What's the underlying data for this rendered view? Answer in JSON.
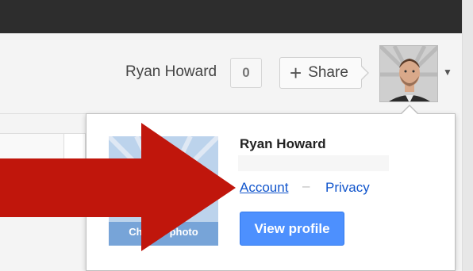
{
  "header": {
    "user_name": "Ryan Howard",
    "notification_count": "0",
    "share_label": "Share"
  },
  "popup": {
    "name": "Ryan Howard",
    "email": "",
    "account_link": "Account",
    "separator": "–",
    "privacy_link": "Privacy",
    "photo_label": "Change photo",
    "view_profile_label": "View profile"
  },
  "colors": {
    "top_bar": "#2d2d2d",
    "link": "#1155cc",
    "button_blue": "#4d90fe",
    "arrow_red": "#c0160c"
  },
  "icons": [
    "plus-icon",
    "chevron-down-icon",
    "red-arrow-overlay"
  ]
}
